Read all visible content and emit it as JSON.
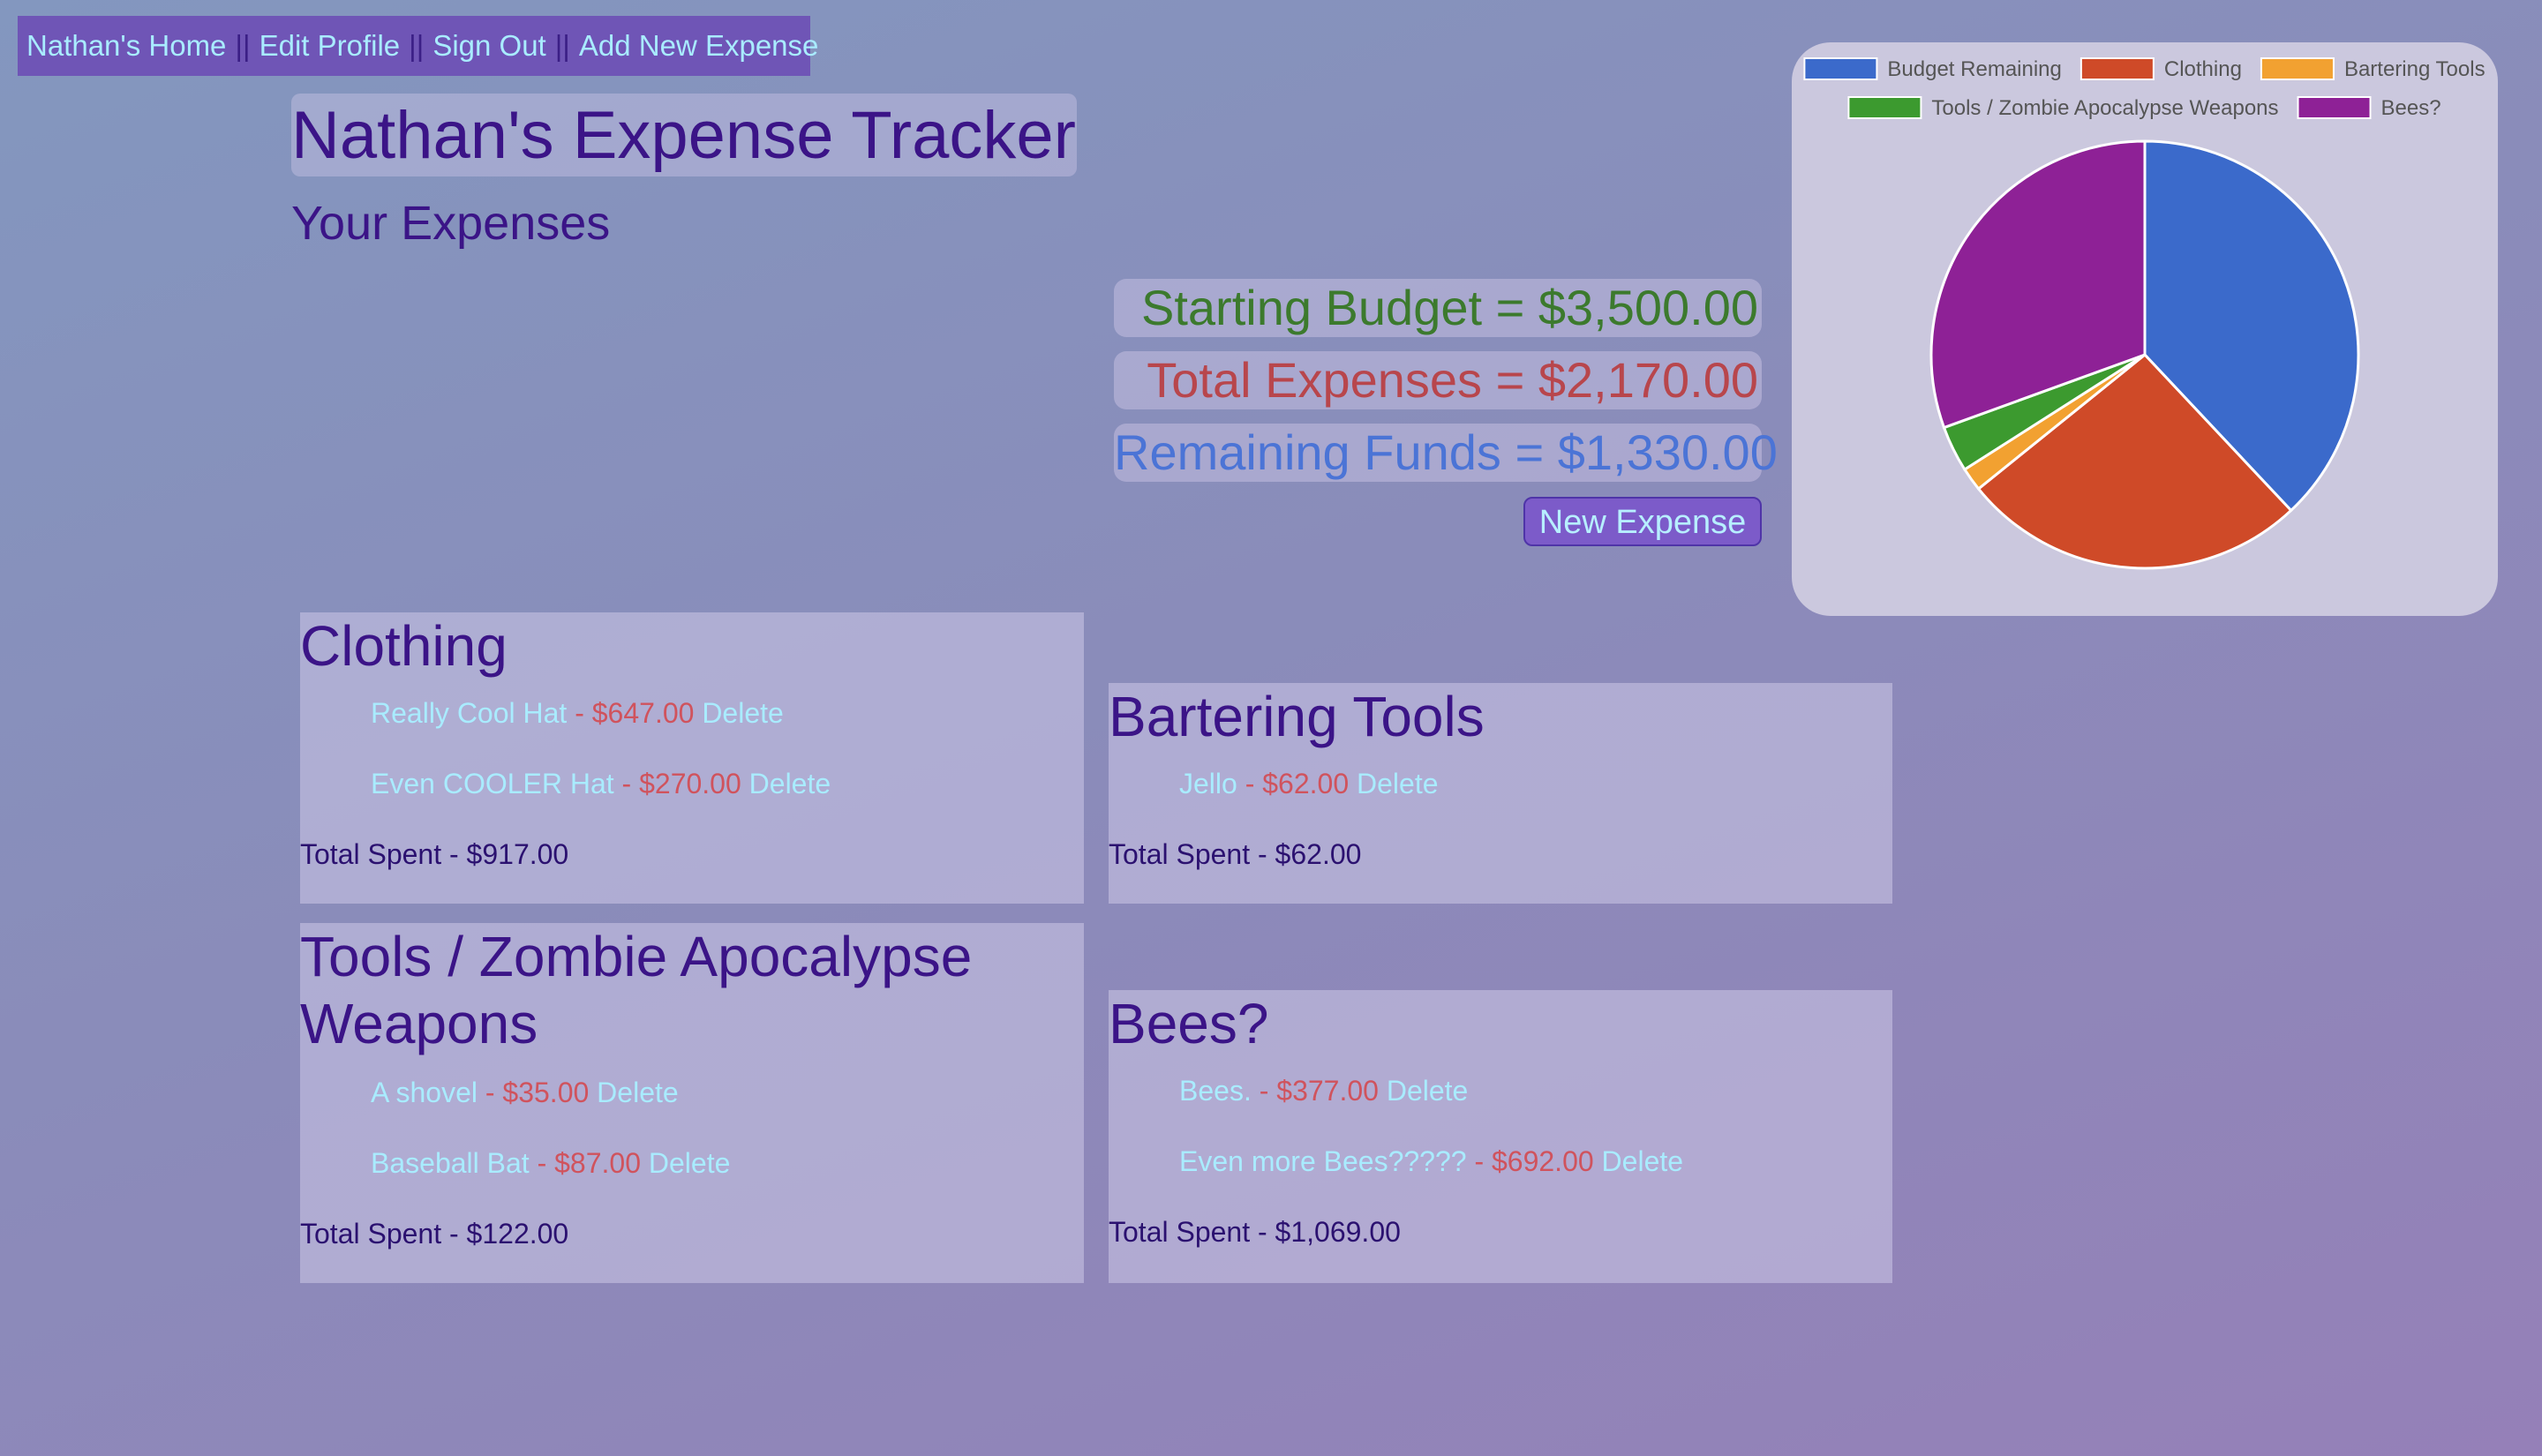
{
  "nav": {
    "home": "Nathan's Home",
    "edit_profile": "Edit Profile",
    "sign_out": "Sign Out",
    "add_expense": "Add New Expense",
    "separator": "||"
  },
  "page": {
    "title": "Nathan's Expense Tracker",
    "subtitle": "Your Expenses"
  },
  "summary": {
    "starting_budget": "Starting Budget = $3,500.00",
    "total_expenses": "Total Expenses = $2,170.00",
    "remaining_funds": "Remaining Funds = $1,330.00",
    "new_expense_button": "New Expense"
  },
  "categories": [
    {
      "name": "Clothing",
      "items": [
        {
          "name": "Really Cool Hat",
          "price": "$647.00",
          "delete": "Delete"
        },
        {
          "name": "Even COOLER Hat",
          "price": "$270.00",
          "delete": "Delete"
        }
      ],
      "total": "Total Spent - $917.00"
    },
    {
      "name": "Bartering Tools",
      "items": [
        {
          "name": "Jello",
          "price": "$62.00",
          "delete": "Delete"
        }
      ],
      "total": "Total Spent - $62.00"
    },
    {
      "name": "Tools / Zombie Apocalypse Weapons",
      "items": [
        {
          "name": "A shovel",
          "price": "$35.00",
          "delete": "Delete"
        },
        {
          "name": "Baseball Bat",
          "price": "$87.00",
          "delete": "Delete"
        }
      ],
      "total": "Total Spent - $122.00"
    },
    {
      "name": "Bees?",
      "items": [
        {
          "name": "Bees.",
          "price": "$377.00",
          "delete": "Delete"
        },
        {
          "name": "Even more Bees?????",
          "price": "$692.00",
          "delete": "Delete"
        }
      ],
      "total": "Total Spent - $1,069.00"
    }
  ],
  "dash": " - ",
  "colors": {
    "starting_budget": "#3c7a2d",
    "total_expenses": "#b8464c",
    "remaining_funds": "#4b74d6",
    "link": "#a9ecff",
    "price": "#d0535d",
    "heading": "#3b1487"
  },
  "chart_data": {
    "type": "pie",
    "legend_position": "top",
    "series": [
      {
        "name": "Budget Remaining",
        "value": 1330,
        "color": "#3b6acb"
      },
      {
        "name": "Clothing",
        "value": 917,
        "color": "#cf4a28"
      },
      {
        "name": "Bartering Tools",
        "value": 62,
        "color": "#f2a131"
      },
      {
        "name": "Tools / Zombie Apocalypse Weapons",
        "value": 122,
        "color": "#3c9a2f"
      },
      {
        "name": "Bees?",
        "value": 1069,
        "color": "#8e2196"
      }
    ]
  }
}
